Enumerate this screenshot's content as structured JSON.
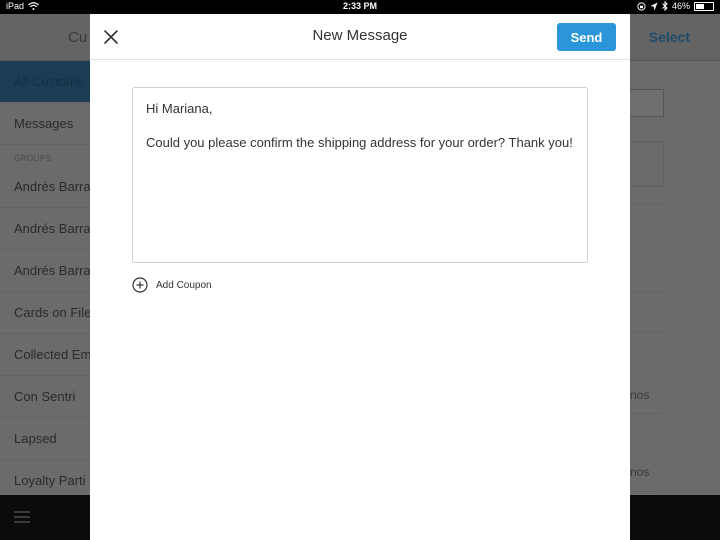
{
  "status_bar": {
    "device": "iPad",
    "time": "2:33 PM",
    "battery": "46%",
    "battery_level": 0.46
  },
  "background": {
    "header_title_fragment": "Cu",
    "select_label": "Select",
    "sidebar": {
      "group_label": "GROUPS",
      "items": [
        "All Custome",
        "Messages",
        "Andrés Barra",
        "Andrés Barra",
        "Andrés Barra",
        "Cards on File",
        "Collected Em",
        "Con Sentri",
        "Lapsed",
        "Loyalty Parti"
      ]
    },
    "right_fragments": [
      "nos",
      "nos"
    ]
  },
  "modal": {
    "title": "New Message",
    "send_label": "Send",
    "message": {
      "greeting": "Hi Mariana,",
      "body": "Could you please confirm the shipping address for your order? Thank you!"
    },
    "add_coupon_label": "Add Coupon"
  },
  "colors": {
    "accent": "#2a96d9"
  }
}
